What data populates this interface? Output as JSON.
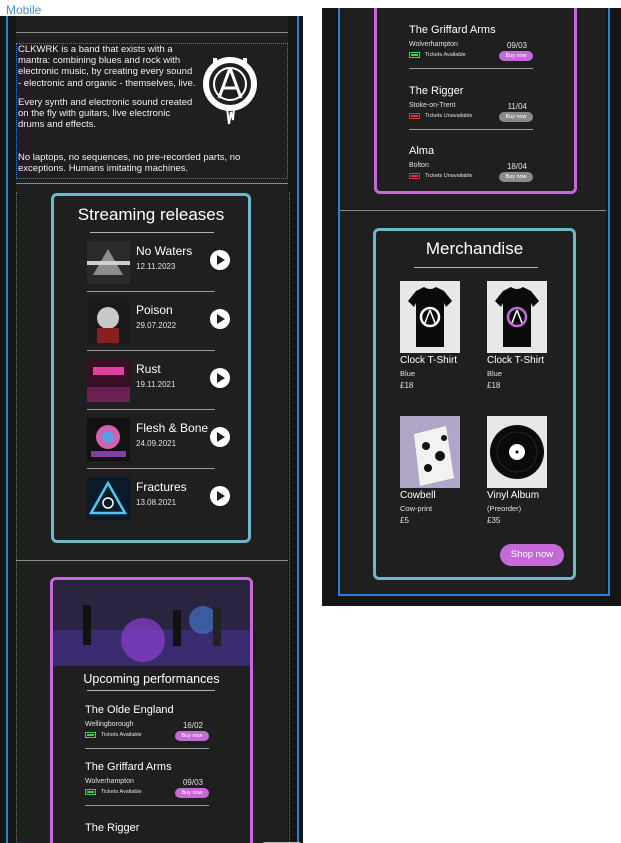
{
  "frame_label": "Mobile",
  "about": {
    "paragraphs": [
      "CLKWRK is a band that exists with a mantra: combining blues and rock with electronic music, by creating every sound - electronic and organic - themselves, live.",
      "Every synth and electronic sound created on the fly with guitars, live electronic drums and effects."
    ],
    "closing": "No laptops, no sequences, no pre-recorded parts, no exceptions. Humans imitating machines."
  },
  "streaming": {
    "title": "Streaming releases",
    "releases": [
      {
        "name": "No Waters",
        "date": "12.11.2023"
      },
      {
        "name": "Poison",
        "date": "29.07.2022"
      },
      {
        "name": "Rust",
        "date": "19.11.2021"
      },
      {
        "name": "Flesh & Bone",
        "date": "24.09.2021"
      },
      {
        "name": "Fractures",
        "date": "13.08.2021"
      }
    ]
  },
  "performances": {
    "title": "Upcoming performances",
    "venues": [
      {
        "name": "The Olde England",
        "city": "Wellingborough",
        "date": "16/02",
        "status": "Tickets Available",
        "available": true,
        "buy": "Buy now"
      },
      {
        "name": "The Griffard Arms",
        "city": "Wolverhampton",
        "date": "09/03",
        "status": "Tickets Available",
        "available": true,
        "buy": "Buy now"
      },
      {
        "name": "The Rigger",
        "city": "Stoke-on-Trent",
        "date": "11/04",
        "status": "Tickets Unavailable",
        "available": false,
        "buy": "Buy now"
      },
      {
        "name": "Alma",
        "city": "Bolton",
        "date": "18/04",
        "status": "Tickets Unavailable",
        "available": false,
        "buy": "Buy now"
      }
    ]
  },
  "merch": {
    "title": "Merchandise",
    "items": [
      {
        "name": "Clock T-Shirt",
        "variant": "Blue",
        "price": "£18"
      },
      {
        "name": "Clock T-Shirt",
        "variant": "Blue",
        "price": "£18"
      },
      {
        "name": "Cowbell",
        "variant": "Cow-print",
        "price": "£5"
      },
      {
        "name": "Vinyl Album",
        "variant": "(Preorder)",
        "price": "£35"
      }
    ],
    "shop_label": "Shop now"
  },
  "colors": {
    "accent_purple": "#c46ad7",
    "accent_teal": "#6cb7c9",
    "guide_blue": "#2b7fd4",
    "ticket_green": "#3fcf5c",
    "ticket_red": "#e0303a"
  }
}
